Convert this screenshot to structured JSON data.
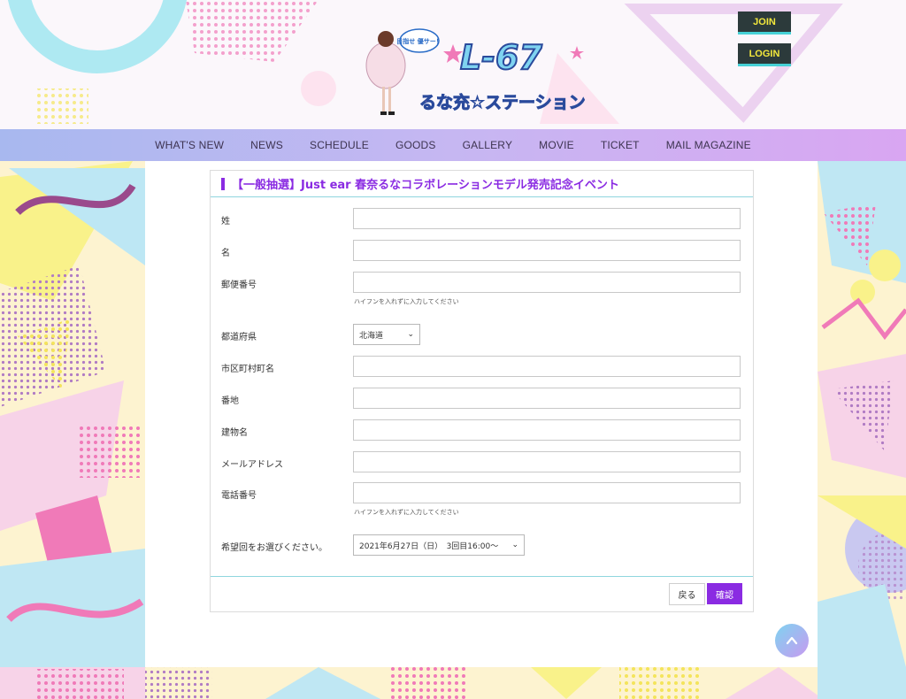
{
  "header": {
    "logo_top": "目指せ 優サー！",
    "logo_main": "L-67",
    "logo_sub": "るな充☆ステーション",
    "join_label": "JOIN",
    "login_label": "LOGIN"
  },
  "nav": {
    "items": [
      "WHAT'S NEW",
      "NEWS",
      "SCHEDULE",
      "GOODS",
      "GALLERY",
      "MOVIE",
      "TICKET",
      "MAIL MAGAZINE"
    ]
  },
  "form": {
    "title": "【一般抽選】Just ear 春奈るなコラボレーションモデル発売記念イベント",
    "last_name_label": "姓",
    "first_name_label": "名",
    "postal_label": "郵便番号",
    "postal_hint": "ハイフンを入れずに入力してください",
    "prefecture_label": "都道府県",
    "prefecture_value": "北海道",
    "city_label": "市区町村町名",
    "address_label": "番地",
    "building_label": "建物名",
    "email_label": "メールアドレス",
    "phone_label": "電話番号",
    "phone_hint": "ハイフンを入れずに入力してください",
    "session_label": "希望回をお選びください。",
    "session_value": "2021年6月27日（日）　3回目16:00～",
    "back_label": "戻る",
    "confirm_label": "確認"
  },
  "colors": {
    "accent": "#8a2be2",
    "auth_bg": "#2c3a3b",
    "auth_text": "#f3e83c",
    "divider": "#8fd6de"
  },
  "icons": {
    "scroll_top": "chevron-up-icon",
    "select_arrow": "chevron-down-icon"
  }
}
